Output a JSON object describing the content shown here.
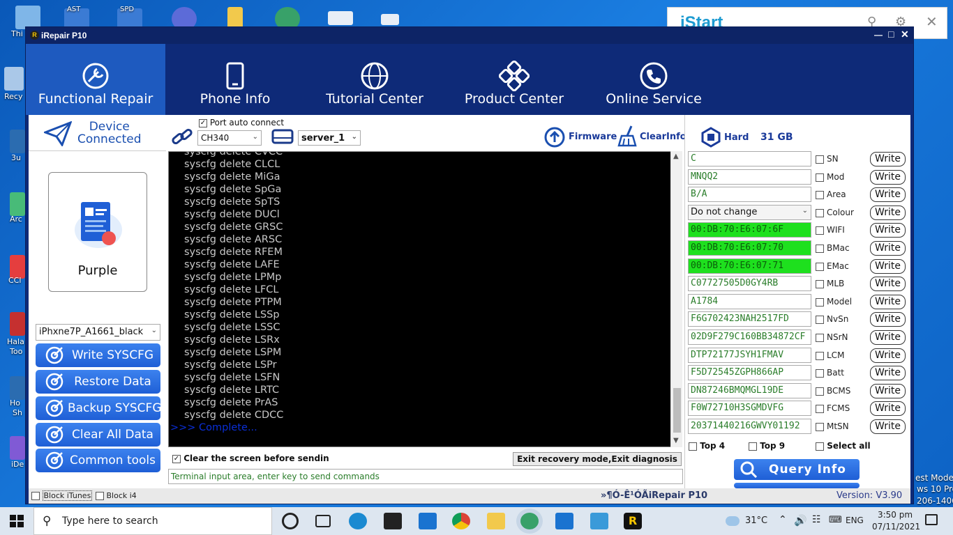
{
  "desktop": {
    "icon_labels": [
      "Thi",
      "Recy",
      "3u",
      "Arc",
      "CCl",
      "Hala",
      "Too",
      "Ho",
      "Sh",
      "iDe"
    ],
    "top_icon_labels": [
      "AST",
      "SPD"
    ],
    "right_overlay_text": [
      "est Mode",
      "ws 10 Pro",
      "206-1406"
    ],
    "istart": {
      "logo": "iStart"
    }
  },
  "window": {
    "title": "iRepair P10",
    "controls": [
      "—",
      "□",
      "✕"
    ]
  },
  "nav": {
    "items": [
      {
        "label": "Functional Repair",
        "icon": "wrench-icon",
        "active": true
      },
      {
        "label": "Phone Info",
        "icon": "phone-icon"
      },
      {
        "label": "Tutorial Center",
        "icon": "globe-icon"
      },
      {
        "label": "Product Center",
        "icon": "grid-icon"
      },
      {
        "label": "Online Service",
        "icon": "headset-icon"
      }
    ]
  },
  "left": {
    "device_status_line1": "Device",
    "device_status_line2": "Connected",
    "card_name": "Purple",
    "model_select": "iPhxne7P_A1661_black",
    "buttons": [
      "Write SYSCFG",
      "Restore Data",
      "Backup SYSCFG",
      "Clear All Data",
      "Common tools"
    ]
  },
  "toolbar": {
    "port_auto_label": "Port auto connect",
    "port_select": "CH340",
    "server_select": "server_1",
    "firmware_label": "Firmware",
    "clearinfo_label": "ClearInfo"
  },
  "terminal": {
    "lines": [
      "syscfg delete CVCC",
      "syscfg delete CLCL",
      "syscfg delete MiGa",
      "syscfg delete SpGa",
      "syscfg delete SpTS",
      "syscfg delete DUCl",
      "syscfg delete GRSC",
      "syscfg delete ARSC",
      "syscfg delete RFEM",
      "syscfg delete LAFE",
      "syscfg delete LPMp",
      "syscfg delete LFCL",
      "syscfg delete PTPM",
      "syscfg delete LSSp",
      "syscfg delete LSSC",
      "syscfg delete LSRx",
      "syscfg delete LSPM",
      "syscfg delete LSPr",
      "syscfg delete LSFN",
      "syscfg delete LRTC",
      "syscfg delete PrAS",
      "syscfg delete CDCC"
    ],
    "complete": ">>> Complete...",
    "clear_screen_label": "Clear the screen before sendin",
    "exit_button": "Exit recovery mode,Exit diagnosis",
    "input_placeholder": "Terminal input area, enter key to send commands"
  },
  "right": {
    "hard_label": "Hard",
    "hard_size": "31 GB",
    "fields": [
      {
        "value": "C",
        "label": "SN",
        "green": false
      },
      {
        "value": "MNQQ2",
        "label": "Mod",
        "green": false
      },
      {
        "value": "B/A",
        "label": "Area",
        "green": false
      },
      {
        "value": "Do not change",
        "label": "Colour",
        "green": false,
        "select": true
      },
      {
        "value": "00:DB:70:E6:07:6F",
        "label": "WIFI",
        "green": true
      },
      {
        "value": "00:DB:70:E6:07:70",
        "label": "BMac",
        "green": true
      },
      {
        "value": "00:DB:70:E6:07:71",
        "label": "EMac",
        "green": true
      },
      {
        "value": "C07727505D0GY4RB",
        "label": "MLB",
        "green": false
      },
      {
        "value": "A1784",
        "label": "Model",
        "green": false
      },
      {
        "value": "F6G702423NAH2517FD",
        "label": "NvSn",
        "green": false
      },
      {
        "value": "02D9F279C160BB34872CF",
        "label": "NSrN",
        "green": false
      },
      {
        "value": "DTP72177JSYH1FMAV",
        "label": "LCM",
        "green": false
      },
      {
        "value": "F5D72545ZGPH866AP",
        "label": "Batt",
        "green": false
      },
      {
        "value": "DN87246BMQMGL19DE",
        "label": "BCMS",
        "green": false
      },
      {
        "value": "F0W72710H3SGMDVFG",
        "label": "FCMS",
        "green": false
      },
      {
        "value": "20371440216GWVY01192",
        "label": "MtSN",
        "green": false
      }
    ],
    "write_label": "Write",
    "top4": "Top 4",
    "top9": "Top 9",
    "select_all": "Select all",
    "query_button": "Query Info"
  },
  "status": {
    "block_itunes": "Block iTunes",
    "block_i4": "Block i4",
    "center": "»¶Ó-Ê¹ÓÃiRepair P10",
    "version": "Version: V3.90"
  },
  "taskbar": {
    "search_placeholder": "Type here to search",
    "temperature": "31°C",
    "language": "ENG",
    "time": "3:50 pm",
    "date": "07/11/2021"
  },
  "colors": {
    "nav_bg": "#0e2a78",
    "nav_active": "#1e5abf",
    "button_blue": "#2a6be0",
    "mac_green": "#1ee01e"
  }
}
